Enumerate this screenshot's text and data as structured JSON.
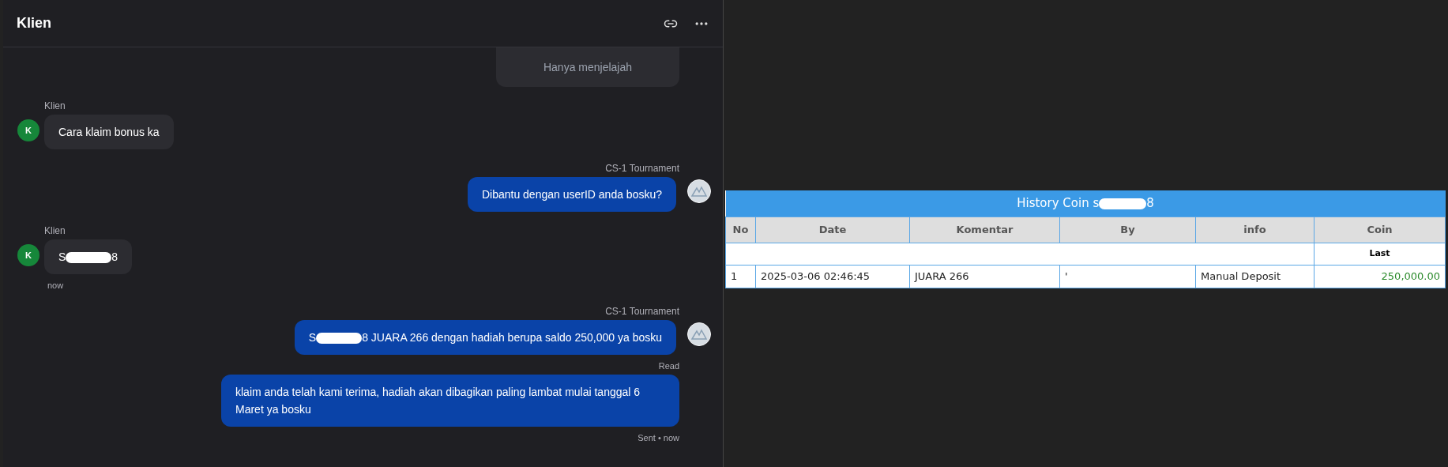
{
  "chat": {
    "title": "Klien",
    "messages": [
      {
        "kind": "preview",
        "text": "Hanya menjelajah"
      },
      {
        "kind": "incoming",
        "sender": "Klien",
        "avatar": "K",
        "text": "Cara klaim bonus ka"
      },
      {
        "kind": "outgoing",
        "sender": "CS-1 Tournament",
        "text": "Dibantu dengan userID anda bosku?"
      },
      {
        "kind": "incoming",
        "sender": "Klien",
        "avatar": "K",
        "text": "S",
        "redacted_suffix": "8",
        "status": "now"
      },
      {
        "kind": "outgoing",
        "sender": "CS-1 Tournament",
        "text": "S",
        "redacted_suffix": "8 JUARA 266 dengan hadiah berupa saldo 250,000 ya bosku",
        "status": "Read"
      },
      {
        "kind": "outgoing",
        "text": "klaim anda telah kami terima, hadiah akan dibagikan paling lambat mulai tanggal 6 Maret ya bosku",
        "status": "Sent • now"
      }
    ]
  },
  "history": {
    "title": "History Coin s",
    "title_suffix": "8",
    "columns": [
      "No",
      "Date",
      "Komentar",
      "By",
      "info",
      "Coin"
    ],
    "subheader": "Last",
    "rows": [
      {
        "no": "1",
        "date": "2025-03-06 02:46:45",
        "komentar": "JUARA 266",
        "by": "'",
        "info": "Manual Deposit",
        "coin": "250,000.00"
      }
    ]
  }
}
